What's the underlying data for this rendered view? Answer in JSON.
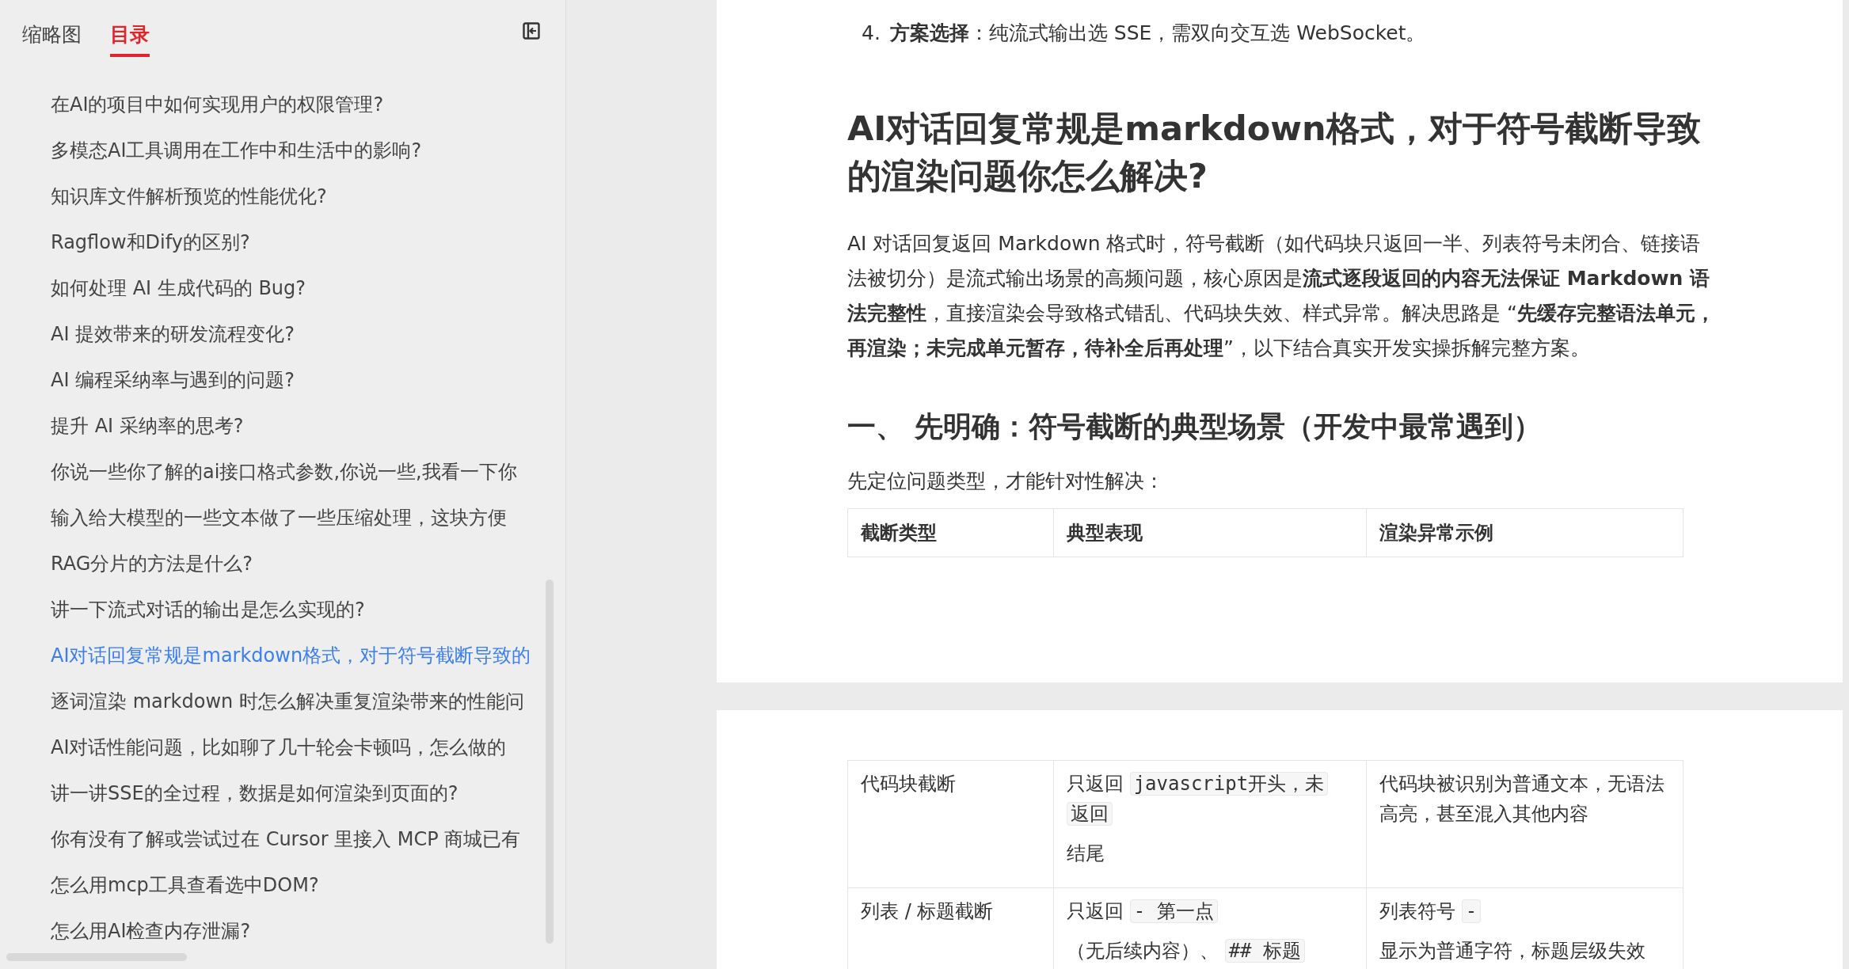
{
  "sidebar": {
    "tabs": [
      {
        "label": "缩略图",
        "selected": false
      },
      {
        "label": "目录",
        "selected": true
      }
    ],
    "items": [
      {
        "label": "在AI的项目中如何实现用户的权限管理?",
        "selected": false
      },
      {
        "label": "多模态AI工具调用在工作中和生活中的影响?",
        "selected": false
      },
      {
        "label": "知识库文件解析预览的性能优化?",
        "selected": false
      },
      {
        "label": "Ragflow和Dify的区别?",
        "selected": false
      },
      {
        "label": "如何处理 AI 生成代码的 Bug?",
        "selected": false
      },
      {
        "label": "AI 提效带来的研发流程变化?",
        "selected": false
      },
      {
        "label": "AI 编程采纳率与遇到的问题?",
        "selected": false
      },
      {
        "label": "提升 AI 采纳率的思考?",
        "selected": false
      },
      {
        "label": "你说一些你了解的ai接口格式参数,你说一些,我看一下你",
        "selected": false
      },
      {
        "label": "输入给大模型的一些文本做了一些压缩处理，这块方便",
        "selected": false
      },
      {
        "label": "RAG分片的方法是什么?",
        "selected": false
      },
      {
        "label": "讲一下流式对话的输出是怎么实现的?",
        "selected": false
      },
      {
        "label": "AI对话回复常规是markdown格式，对于符号截断导致的",
        "selected": true
      },
      {
        "label": "逐词渲染 markdown 时怎么解决重复渲染带来的性能问",
        "selected": false
      },
      {
        "label": "AI对话性能问题，比如聊了几十轮会卡顿吗，怎么做的",
        "selected": false
      },
      {
        "label": "讲一讲SSE的全过程，数据是如何渲染到页面的?",
        "selected": false
      },
      {
        "label": "你有没有了解或尝试过在 Cursor 里接入 MCP 商城已有",
        "selected": false
      },
      {
        "label": "怎么用mcp工具查看选中DOM?",
        "selected": false
      },
      {
        "label": "怎么用AI检查内存泄漏?",
        "selected": false
      }
    ]
  },
  "document": {
    "list_item": {
      "number": "4.",
      "text": "**方案选择**：纯流式输出选 SSE，需双向交互选 WebSocket。"
    },
    "heading": "AI对话回复常规是markdown格式，对于符号截断导致的渲染问题你怎么解决?",
    "paragraph": "AI 对话回复返回 Markdown 格式时，符号截断（如代码块只返回一半、列表符号未闭合、链接语法被切分）是流式输出场景的高频问题，核心原因是**流式逐段返回的内容无法保证 Markdown 语法完整性**，直接渲染会导致格式错乱、代码块失效、样式异常。解决思路是 “**先缓存完整语法单元，再渲染；未完成单元暂存，待补全后再处理**”，以下结合真实开发实操拆解完整方案。",
    "section_heading": "一、 先明确：符号截断的典型场景（开发中最常遇到）",
    "intro": "先定位问题类型，才能针对性解决：",
    "table": {
      "columns": [
        "截断类型",
        "典型表现",
        "渲染异常示例"
      ],
      "rows": [
        [
          [
            [
              {
                "kind": "text",
                "text": "代码块截断"
              }
            ]
          ],
          [
            [
              {
                "kind": "text",
                "text": "只返回 "
              },
              {
                "kind": "code",
                "text": "javascript开头，未"
              },
              {
                "kind": "code",
                "text": "返回"
              }
            ],
            [
              {
                "kind": "text",
                "text": "结尾"
              }
            ]
          ],
          [
            [
              {
                "kind": "text",
                "text": "代码块被识别为普通文本，无语法高亮，甚至混入其他内容"
              }
            ]
          ]
        ],
        [
          [
            [
              {
                "kind": "text",
                "text": "列表 / 标题截断"
              }
            ]
          ],
          [
            [
              {
                "kind": "text",
                "text": "只返回 "
              },
              {
                "kind": "code",
                "text": "- 第一点"
              }
            ],
            [
              {
                "kind": "text",
                "text": "（无后续内容）、 "
              },
              {
                "kind": "code",
                "text": "## 标题"
              }
            ]
          ],
          [
            [
              {
                "kind": "text",
                "text": "列表符号 "
              },
              {
                "kind": "code",
                "text": "-"
              }
            ],
            [
              {
                "kind": "text",
                "text": "显示为普通字符，标题层级失效"
              }
            ]
          ]
        ]
      ]
    }
  }
}
